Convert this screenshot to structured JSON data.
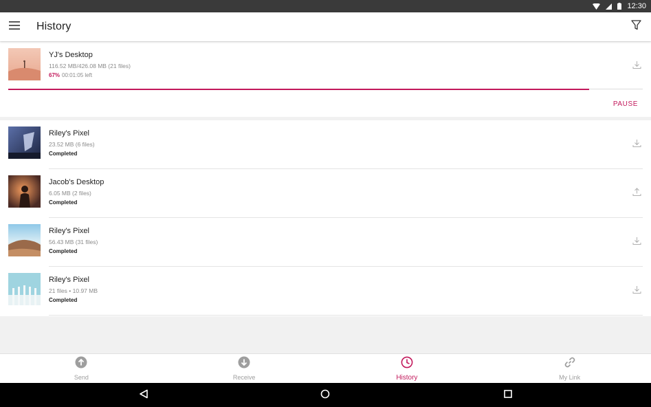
{
  "status_bar": {
    "time": "12:30"
  },
  "app_bar": {
    "title": "History"
  },
  "active_transfer": {
    "name": "YJ's Desktop",
    "size": "116.52 MB/426.08 MB (21 files)",
    "percent_text": "67%",
    "time_left": "00:01:05 left",
    "progress": 0.915,
    "pause_label": "PAUSE",
    "direction_icon": "download-icon"
  },
  "transfers": [
    {
      "name": "Riley's Pixel",
      "size": "23.52 MB (6 files)",
      "status": "Completed",
      "direction_icon": "download-icon"
    },
    {
      "name": "Jacob's Desktop",
      "size": "6.05 MB (2 files)",
      "status": "Completed",
      "direction_icon": "upload-icon"
    },
    {
      "name": "Riley's Pixel",
      "size": "56.43 MB (31 files)",
      "status": "Completed",
      "direction_icon": "download-icon"
    },
    {
      "name": "Riley's Pixel",
      "size": "21 files • 10.97 MB",
      "status": "Completed",
      "direction_icon": "download-icon"
    }
  ],
  "bottom_nav": {
    "send": "Send",
    "receive": "Receive",
    "history": "History",
    "my_link": "My Link"
  },
  "colors": {
    "accent": "#c2185b",
    "status_bar": "#3a3a3a",
    "background": "#f1f1f1"
  }
}
